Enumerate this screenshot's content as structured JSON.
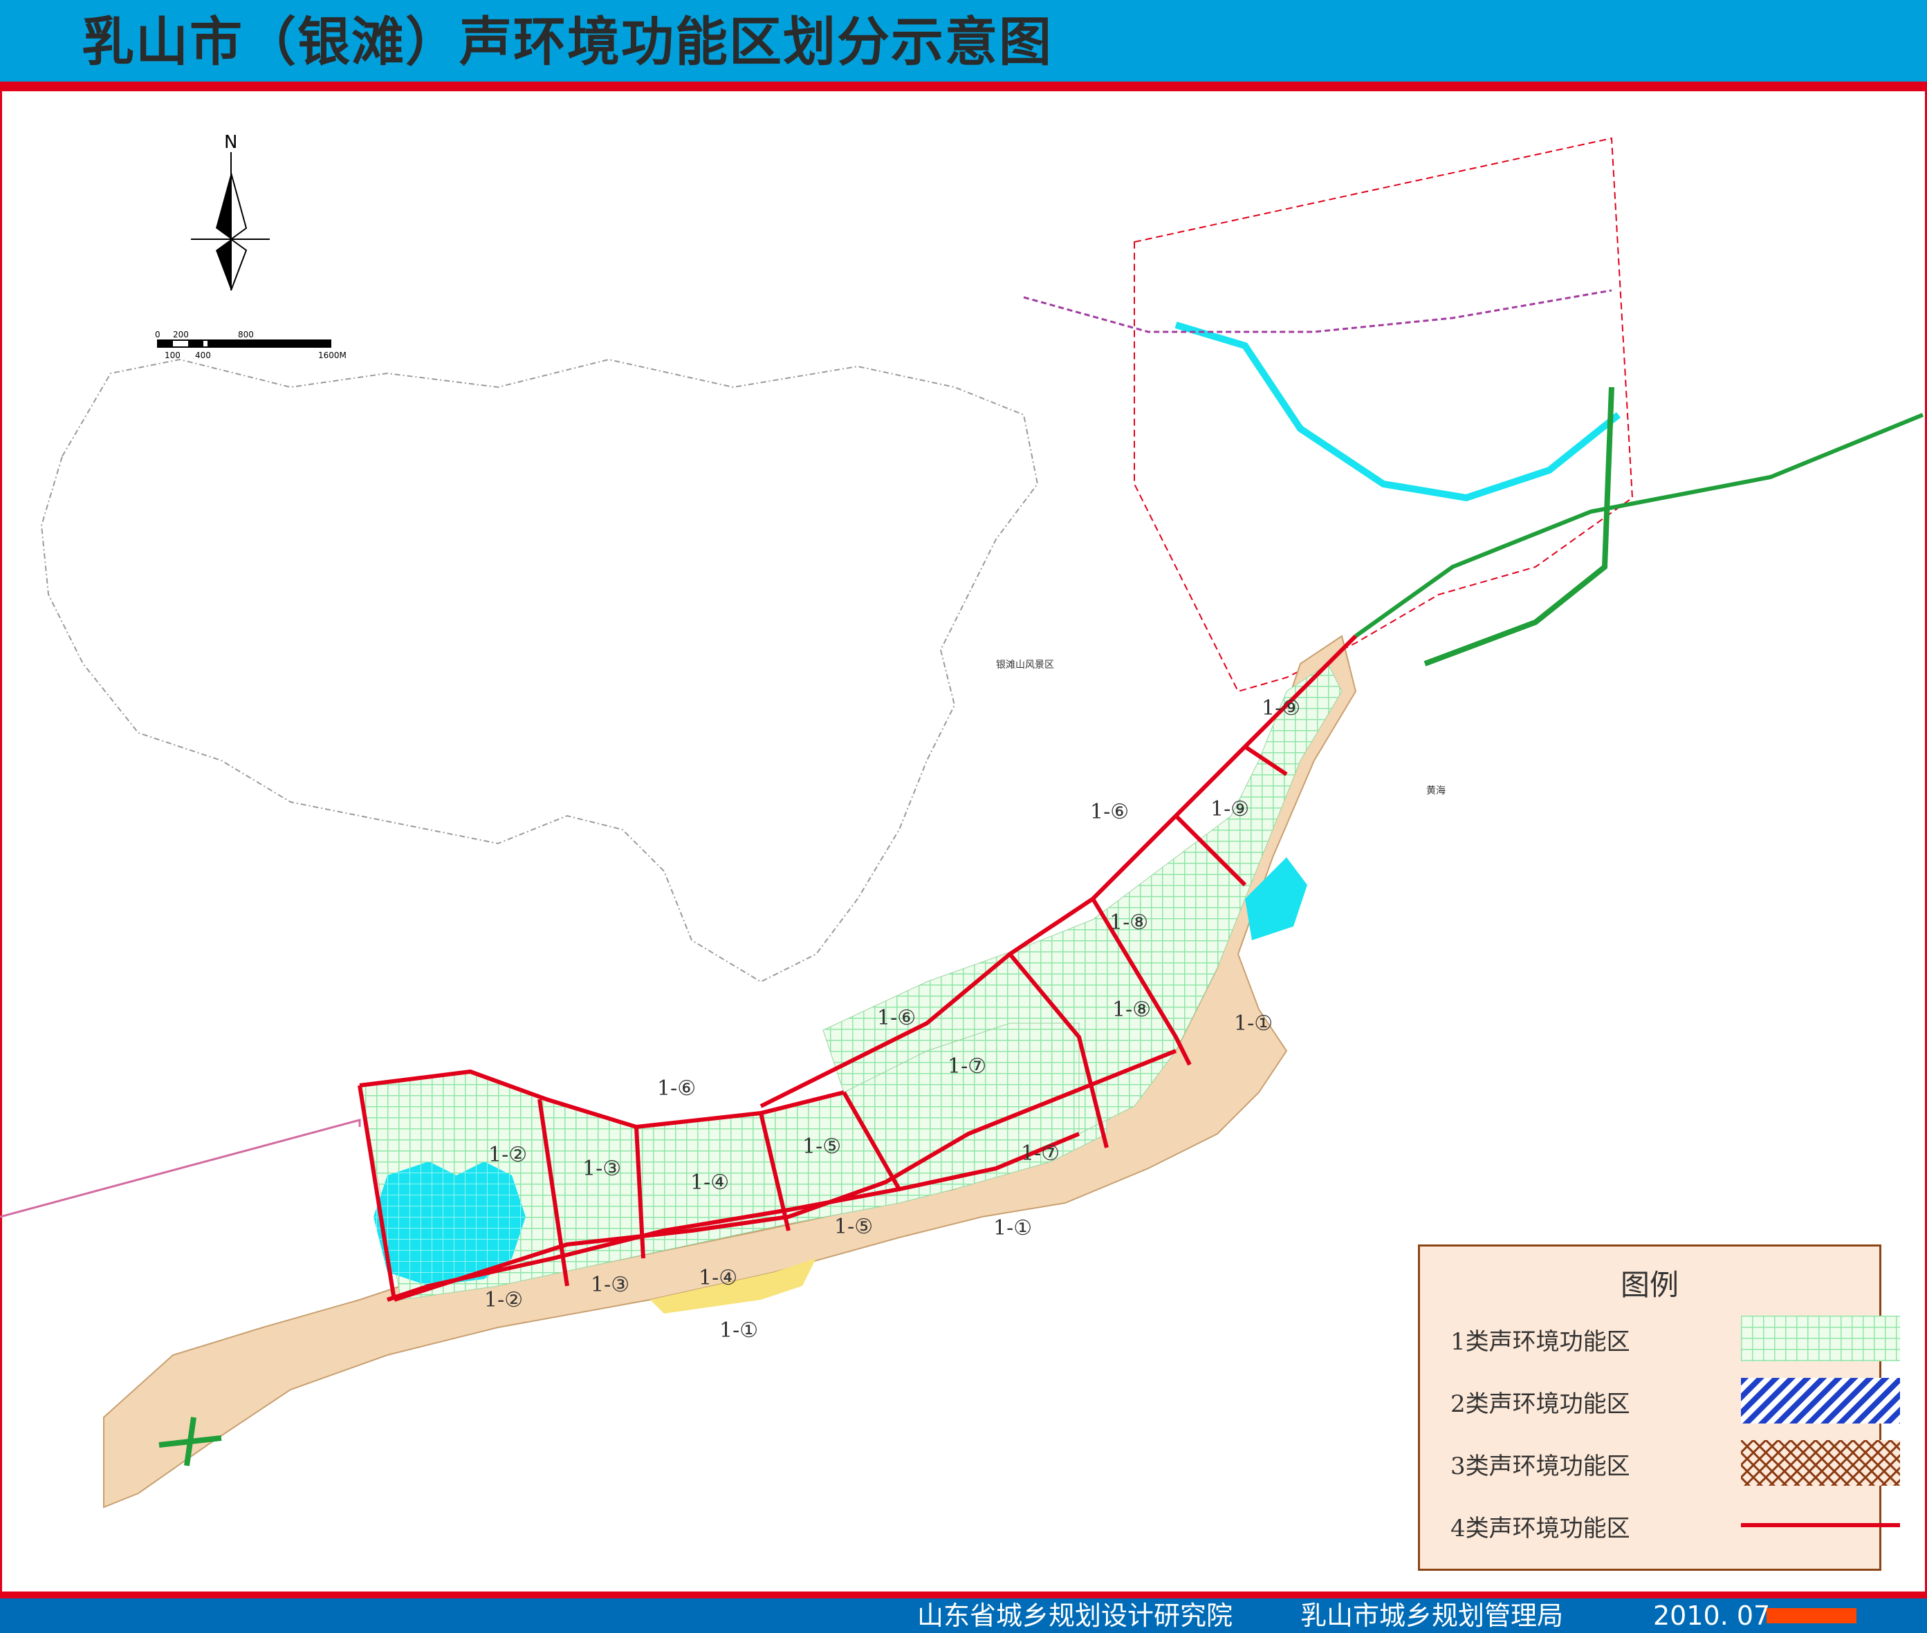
{
  "title": "乳山市（银滩）声环境功能区划分示意图",
  "north_label": "N",
  "scale_bar": {
    "ticks_top": [
      "0",
      "200",
      "800"
    ],
    "ticks_bottom": [
      "100",
      "400",
      "1600M"
    ]
  },
  "map_labels": {
    "scenic_area": "银滩山风景区",
    "sea": "黄海"
  },
  "zone_labels": [
    {
      "id": "z1",
      "text": "1-①"
    },
    {
      "id": "z2",
      "text": "1-①"
    },
    {
      "id": "z3",
      "text": "1-①"
    },
    {
      "id": "z4",
      "text": "1-②"
    },
    {
      "id": "z5",
      "text": "1-②"
    },
    {
      "id": "z6",
      "text": "1-③"
    },
    {
      "id": "z7",
      "text": "1-③"
    },
    {
      "id": "z8",
      "text": "1-④"
    },
    {
      "id": "z9",
      "text": "1-④"
    },
    {
      "id": "z10",
      "text": "1-⑤"
    },
    {
      "id": "z11",
      "text": "1-⑤"
    },
    {
      "id": "z12",
      "text": "1-⑥"
    },
    {
      "id": "z13",
      "text": "1-⑥"
    },
    {
      "id": "z14",
      "text": "1-⑥"
    },
    {
      "id": "z15",
      "text": "1-⑦"
    },
    {
      "id": "z16",
      "text": "1-⑦"
    },
    {
      "id": "z17",
      "text": "1-⑧"
    },
    {
      "id": "z18",
      "text": "1-⑧"
    },
    {
      "id": "z19",
      "text": "1-⑨"
    },
    {
      "id": "z20",
      "text": "1-⑨"
    }
  ],
  "legend": {
    "title": "图例",
    "items": [
      {
        "label": "1类声环境功能区",
        "pattern": "green-grid",
        "color": "#8fe6a8"
      },
      {
        "label": "2类声环境功能区",
        "pattern": "blue-hatch",
        "color": "#1e40c8"
      },
      {
        "label": "3类声环境功能区",
        "pattern": "brown-crosshatch",
        "color": "#8b3a12"
      },
      {
        "label": "4类声环境功能区",
        "pattern": "red-line",
        "color": "#e0001a"
      }
    ]
  },
  "footer": {
    "org1": "山东省城乡规划设计研究院",
    "org2": "乳山市城乡规划管理局",
    "date": "2010. 07"
  },
  "colors": {
    "header_bg": "#00a0dc",
    "accent_red": "#e0001a",
    "footer_bg": "#006bb6",
    "land_tan": "#f3d6b4",
    "water_cyan": "#19e3f0",
    "road_green": "#1f9e3a"
  }
}
